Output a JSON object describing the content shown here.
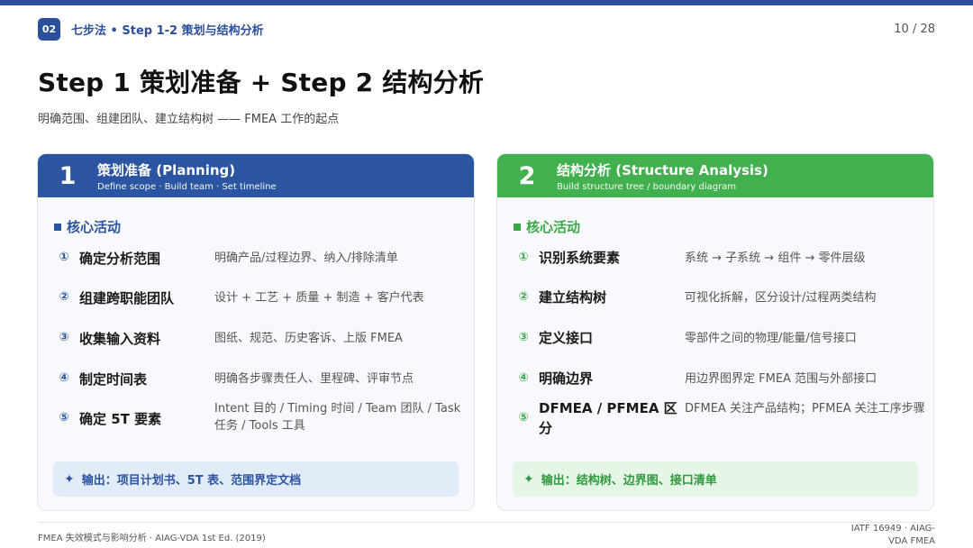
{
  "header": {
    "section_number": "02",
    "section_label": "七步法 • Step 1-2 策划与结构分析",
    "page_number": "10 / 28"
  },
  "title": "Step 1 策划准备 + Step 2 结构分析",
  "subtitle": "明确范围、组建团队、建立结构树 —— FMEA 工作的起点",
  "cards": [
    {
      "number": "1",
      "title": "策划准备 (Planning)",
      "subtitle": "Define scope · Build team · Set timeline",
      "header_color": "#2b55a0",
      "section_label": "核心活动",
      "items": [
        {
          "num": "①",
          "name": "确定分析范围",
          "desc": "明确产品/过程边界、纳入/排除清单"
        },
        {
          "num": "②",
          "name": "组建跨职能团队",
          "desc": "设计 + 工艺 + 质量 + 制造 + 客户代表"
        },
        {
          "num": "③",
          "name": "收集输入资料",
          "desc": "图纸、规范、历史客诉、上版 FMEA"
        },
        {
          "num": "④",
          "name": "制定时间表",
          "desc": "明确各步骤责任人、里程碑、评审节点"
        },
        {
          "num": "⑤",
          "name": "确定 5T 要素",
          "desc": "Intent 目的 / Timing 时间 / Team 团队 / Task 任务 / Tools 工具"
        }
      ],
      "output": "输出：项目计划书、5T 表、范围界定文档"
    },
    {
      "number": "2",
      "title": "结构分析 (Structure Analysis)",
      "subtitle": "Build structure tree / boundary diagram",
      "header_color": "#42b04f",
      "section_label": "核心活动",
      "items": [
        {
          "num": "①",
          "name": "识别系统要素",
          "desc": "系统 → 子系统 → 组件 → 零件层级"
        },
        {
          "num": "②",
          "name": "建立结构树",
          "desc": "可视化拆解，区分设计/过程两类结构"
        },
        {
          "num": "③",
          "name": "定义接口",
          "desc": "零部件之间的物理/能量/信号接口"
        },
        {
          "num": "④",
          "name": "明确边界",
          "desc": "用边界图界定 FMEA 范围与外部接口"
        },
        {
          "num": "⑤",
          "name": "DFMEA / PFMEA 区分",
          "desc": "DFMEA 关注产品结构；PFMEA 关注工序步骤"
        }
      ],
      "output": "输出：结构树、边界图、接口清单"
    }
  ],
  "footer": {
    "left": "FMEA 失效模式与影响分析 · AIAG-VDA 1st Ed. (2019)",
    "right": "IATF 16949 · AIAG-VDA FMEA"
  },
  "colors": {
    "brand_blue": "#2b4f9b",
    "green": "#42b04f"
  },
  "icons": {
    "section_square": "square-icon",
    "output_marker": "sparkle-icon"
  }
}
